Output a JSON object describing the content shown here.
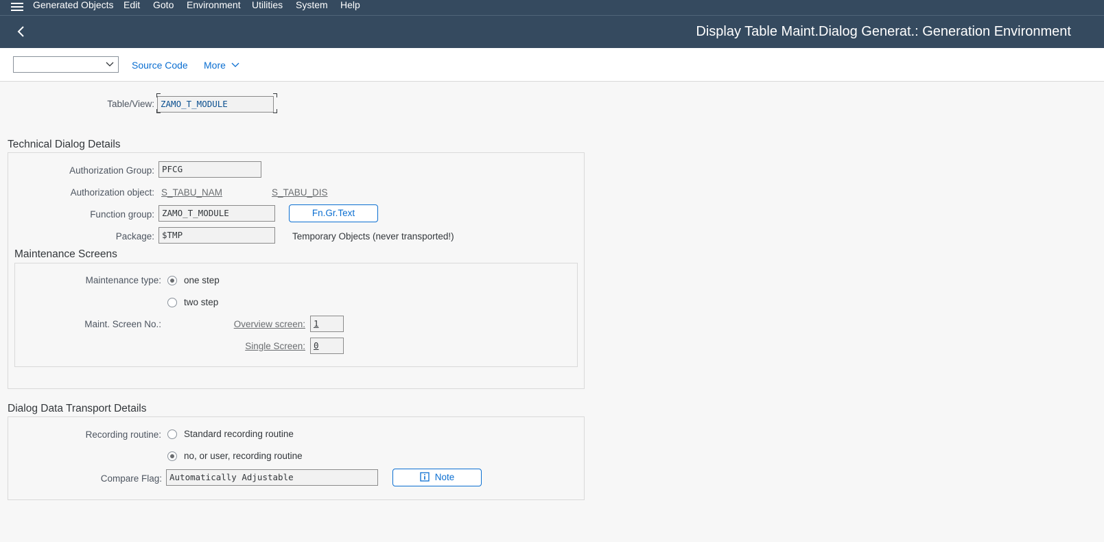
{
  "menu": {
    "items": [
      "Generated Objects",
      "Edit",
      "Goto",
      "Environment",
      "Utilities",
      "System",
      "Help"
    ]
  },
  "title": "Display Table Maint.Dialog Generat.: Generation Environment",
  "toolbar": {
    "select_value": "",
    "source_code_label": "Source Code",
    "more_label": "More"
  },
  "table_view": {
    "label": "Table/View:",
    "value": "ZAMO_T_MODULE"
  },
  "technical": {
    "title": "Technical Dialog Details",
    "auth_group_label": "Authorization Group:",
    "auth_group_value": "PFCG",
    "auth_object_label": "Authorization object:",
    "auth_object_1": "S_TABU_NAM",
    "auth_object_2": "S_TABU_DIS",
    "function_group_label": "Function group:",
    "function_group_value": "ZAMO_T_MODULE",
    "fn_gr_text_button": "Fn.Gr.Text",
    "package_label": "Package:",
    "package_value": "$TMP",
    "package_desc": "Temporary Objects (never transported!)"
  },
  "maintenance": {
    "title": "Maintenance Screens",
    "type_label": "Maintenance type:",
    "one_step": "one step",
    "two_step": "two step",
    "selected": "one step",
    "screen_no_label": "Maint. Screen No.:",
    "overview_label": "Overview screen:",
    "overview_value": "1",
    "single_label": "Single Screen:",
    "single_value": "0"
  },
  "transport": {
    "title": "Dialog Data Transport Details",
    "recording_label": "Recording routine:",
    "standard": "Standard recording routine",
    "user": "no, or user, recording routine",
    "selected": "no, or user, recording routine",
    "compare_label": "Compare Flag:",
    "compare_value": "Automatically Adjustable",
    "note_button": "Note"
  },
  "colors": {
    "shell": "#354a5f",
    "link": "#0a6ed1",
    "background": "#f7f7f7"
  }
}
